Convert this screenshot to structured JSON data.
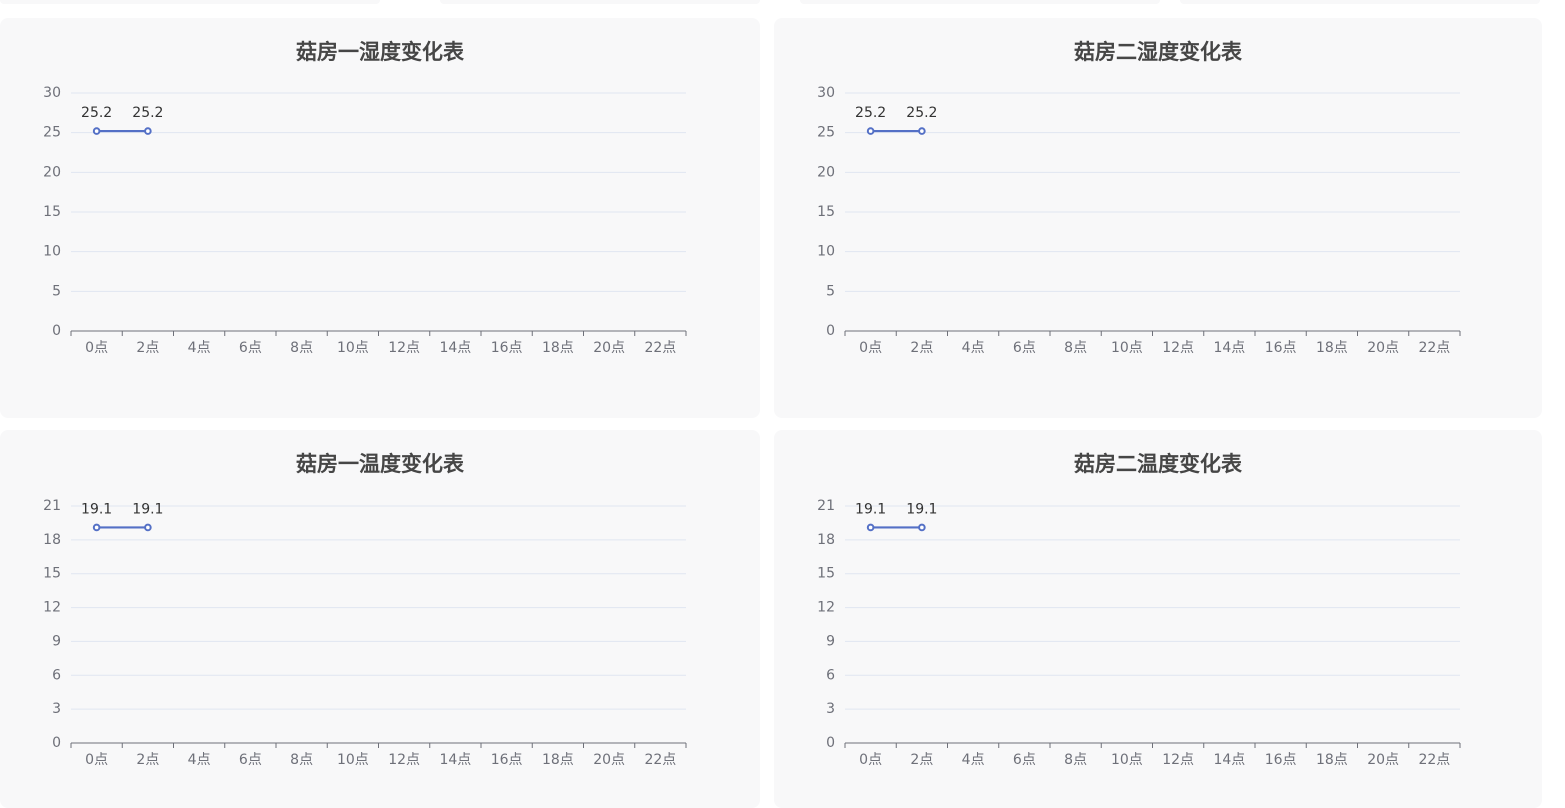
{
  "colors": {
    "panel_bg": "#f8f8f9",
    "line": "#5470c6",
    "grid": "#e0e6f1",
    "axis": "#6e7079",
    "tick_label": "#6e7079",
    "data_label": "#333333",
    "title": "#464646"
  },
  "chart_data": [
    {
      "type": "line",
      "title": "菇房一湿度变化表",
      "categories": [
        "0点",
        "2点",
        "4点",
        "6点",
        "8点",
        "10点",
        "12点",
        "14点",
        "16点",
        "18点",
        "20点",
        "22点"
      ],
      "series": [
        {
          "values": [
            25.2,
            25.2
          ]
        }
      ],
      "ylim": [
        0,
        30
      ],
      "yticks": [
        0,
        5,
        10,
        15,
        20,
        25,
        30
      ],
      "grid": true,
      "data_labels": [
        "25.2",
        "25.2"
      ]
    },
    {
      "type": "line",
      "title": "菇房二湿度变化表",
      "categories": [
        "0点",
        "2点",
        "4点",
        "6点",
        "8点",
        "10点",
        "12点",
        "14点",
        "16点",
        "18点",
        "20点",
        "22点"
      ],
      "series": [
        {
          "values": [
            25.2,
            25.2
          ]
        }
      ],
      "ylim": [
        0,
        30
      ],
      "yticks": [
        0,
        5,
        10,
        15,
        20,
        25,
        30
      ],
      "grid": true,
      "data_labels": [
        "25.2",
        "25.2"
      ]
    },
    {
      "type": "line",
      "title": "菇房一温度变化表",
      "categories": [
        "0点",
        "2点",
        "4点",
        "6点",
        "8点",
        "10点",
        "12点",
        "14点",
        "16点",
        "18点",
        "20点",
        "22点"
      ],
      "series": [
        {
          "values": [
            19.1,
            19.1
          ]
        }
      ],
      "ylim": [
        0,
        21
      ],
      "yticks": [
        0,
        3,
        6,
        9,
        12,
        15,
        18,
        21
      ],
      "grid": true,
      "data_labels": [
        "19.1",
        "19.1"
      ]
    },
    {
      "type": "line",
      "title": "菇房二温度变化表",
      "categories": [
        "0点",
        "2点",
        "4点",
        "6点",
        "8点",
        "10点",
        "12点",
        "14点",
        "16点",
        "18点",
        "20点",
        "22点"
      ],
      "series": [
        {
          "values": [
            19.1,
            19.1
          ]
        }
      ],
      "ylim": [
        0,
        21
      ],
      "yticks": [
        0,
        3,
        6,
        9,
        12,
        15,
        18,
        21
      ],
      "grid": true,
      "data_labels": [
        "19.1",
        "19.1"
      ]
    }
  ]
}
